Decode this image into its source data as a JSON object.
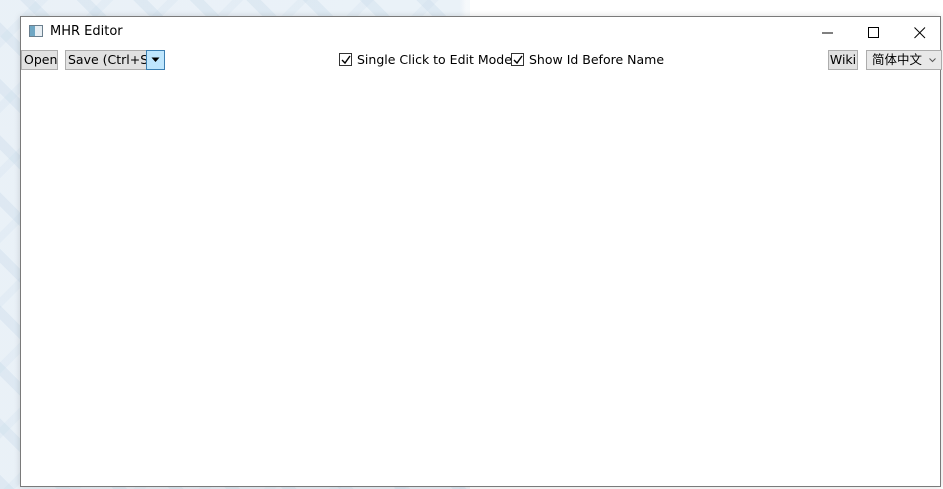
{
  "window": {
    "title": "MHR Editor",
    "icon": "app-window-icon"
  },
  "title_bar": {
    "controls": [
      {
        "name": "minimize",
        "icon": "minimize-icon"
      },
      {
        "name": "maximize",
        "icon": "maximize-icon"
      },
      {
        "name": "close",
        "icon": "close-icon"
      }
    ]
  },
  "toolbar": {
    "open_label": "Open",
    "save_label": "Save (Ctrl+S)",
    "save_dropdown_icon": "chevron-down-icon",
    "single_click_edit": {
      "label": "Single Click to Edit Mode",
      "checked": true
    },
    "show_id_before_name": {
      "label": "Show Id Before Name",
      "checked": true
    },
    "wiki_label": "Wiki",
    "language": {
      "selected": "简体中文"
    }
  },
  "colors": {
    "button_bg": "#e1e1e1",
    "button_border": "#adadad",
    "dropdown_accent_bg": "#bee6fd",
    "dropdown_accent_border": "#3c7fb1",
    "window_border": "#7a7a7a"
  }
}
